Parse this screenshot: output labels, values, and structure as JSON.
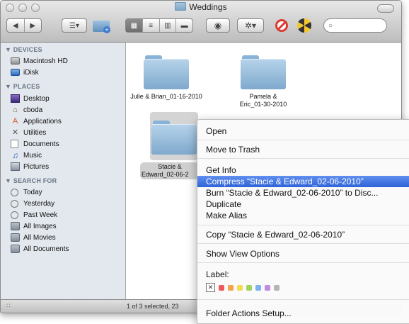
{
  "window": {
    "title": "Weddings",
    "status_text": "1 of 3 selected, 23"
  },
  "sidebar": {
    "sections": [
      {
        "title": "▼ DEVICES",
        "items": [
          {
            "label": "Macintosh HD",
            "icon": "hard-drive-icon"
          },
          {
            "label": "iDisk",
            "icon": "idisk-icon"
          }
        ]
      },
      {
        "title": "▼ PLACES",
        "items": [
          {
            "label": "Desktop",
            "icon": "desktop-icon"
          },
          {
            "label": "cboda",
            "icon": "home-icon"
          },
          {
            "label": "Applications",
            "icon": "applications-icon"
          },
          {
            "label": "Utilities",
            "icon": "utilities-icon"
          },
          {
            "label": "Documents",
            "icon": "documents-icon"
          },
          {
            "label": "Music",
            "icon": "music-icon"
          },
          {
            "label": "Pictures",
            "icon": "pictures-icon"
          }
        ]
      },
      {
        "title": "▼ SEARCH FOR",
        "items": [
          {
            "label": "Today",
            "icon": "clock-icon"
          },
          {
            "label": "Yesterday",
            "icon": "clock-icon"
          },
          {
            "label": "Past Week",
            "icon": "clock-icon"
          },
          {
            "label": "All Images",
            "icon": "smart-folder-icon"
          },
          {
            "label": "All Movies",
            "icon": "smart-folder-icon"
          },
          {
            "label": "All Documents",
            "icon": "smart-folder-icon"
          }
        ]
      }
    ]
  },
  "files": [
    {
      "name_line1": "Julie & Brian_01-16-2010",
      "name_line2": ""
    },
    {
      "name_line1": "Pamela &",
      "name_line2": "Eric_01-30-2010"
    },
    {
      "name_line1": "Stacie &",
      "name_line2": "Edward_02-06-2"
    }
  ],
  "context_menu": {
    "items": [
      "Open",
      "Move to Trash",
      "Get Info",
      "Compress “Stacie & Edward_02-06-2010”",
      "Burn “Stacie & Edward_02-06-2010” to Disc...",
      "Duplicate",
      "Make Alias",
      "Copy “Stacie & Edward_02-06-2010”",
      "Show View Options",
      "Label:",
      "Folder Actions Setup..."
    ],
    "label_none_glyph": "✕",
    "label_colors": [
      "#f0595c",
      "#f6a34b",
      "#f2dc52",
      "#9ed35f",
      "#7cb2ef",
      "#c18be0",
      "#b5b5b5"
    ]
  },
  "colors": {
    "selection": "#2f63d6",
    "sidebar_bg": "#e3e8ee"
  },
  "icons": {
    "back": "◀",
    "forward": "▶",
    "search_glyph": "○",
    "resize_grip": "∷"
  }
}
